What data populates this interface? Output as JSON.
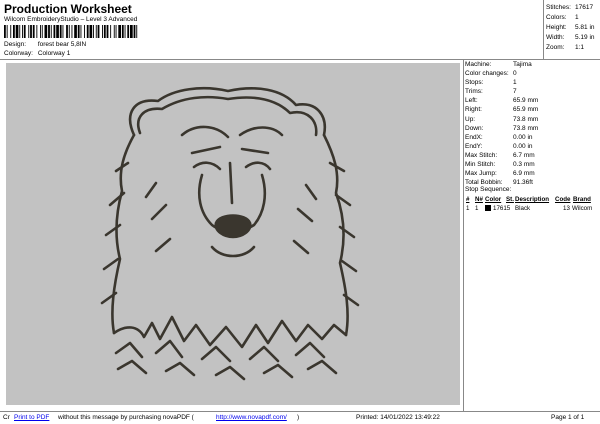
{
  "header": {
    "title": "Production Worksheet",
    "subtitle": "Wilcom EmbroideryStudio – Level 3 Advanced"
  },
  "design": {
    "design_label": "Design:",
    "design_value": "forest bear 5,8IN",
    "colorway_label": "Colorway:",
    "colorway_value": "Colorway 1"
  },
  "stats": [
    {
      "label": "Stitches:",
      "value": "17617"
    },
    {
      "label": "Colors:",
      "value": "1"
    },
    {
      "label": "Height:",
      "value": "5.81 in"
    },
    {
      "label": "Width:",
      "value": "5.19 in"
    },
    {
      "label": "Zoom:",
      "value": "1:1"
    }
  ],
  "details": [
    {
      "label": "Machine:",
      "value": "Tajima"
    },
    {
      "label": "Color changes:",
      "value": "0"
    },
    {
      "label": "Stops:",
      "value": "1"
    },
    {
      "label": "Trims:",
      "value": "7"
    },
    {
      "label": "Left:",
      "value": "65.9 mm"
    },
    {
      "label": "Right:",
      "value": "65.9 mm"
    },
    {
      "label": "Up:",
      "value": "73.8 mm"
    },
    {
      "label": "Down:",
      "value": "73.8 mm"
    },
    {
      "label": "EndX:",
      "value": "0.00 in"
    },
    {
      "label": "EndY:",
      "value": "0.00 in"
    },
    {
      "label": "Max Stitch:",
      "value": "6.7 mm"
    },
    {
      "label": "Min Stitch:",
      "value": "0.3 mm"
    },
    {
      "label": "Max Jump:",
      "value": "6.9 mm"
    },
    {
      "label": "Total Bobbin:",
      "value": "91.36ft"
    }
  ],
  "sequence": {
    "heading": "Stop Sequence:",
    "columns": [
      "#",
      "N#",
      "Color",
      "St.",
      "Description",
      "Code",
      "Brand"
    ],
    "rows": [
      {
        "num": "1",
        "needle": "1",
        "color": "#000000",
        "stitches": "17615",
        "description": "Black",
        "code": "13",
        "brand": "Wilcom"
      }
    ]
  },
  "footer": {
    "cr": "Cr",
    "print_link": "Print to PDF",
    "message": "without this message by purchasing novaPDF (",
    "url": "http://www.novapdf.com/",
    "close": ")",
    "printed": "Printed: 14/01/2022 13:49:22",
    "page": "Page 1 of 1"
  },
  "colors": {
    "preview_bg": "#c2c2c2",
    "thread": "#3a362e",
    "link": "#0000ee"
  }
}
